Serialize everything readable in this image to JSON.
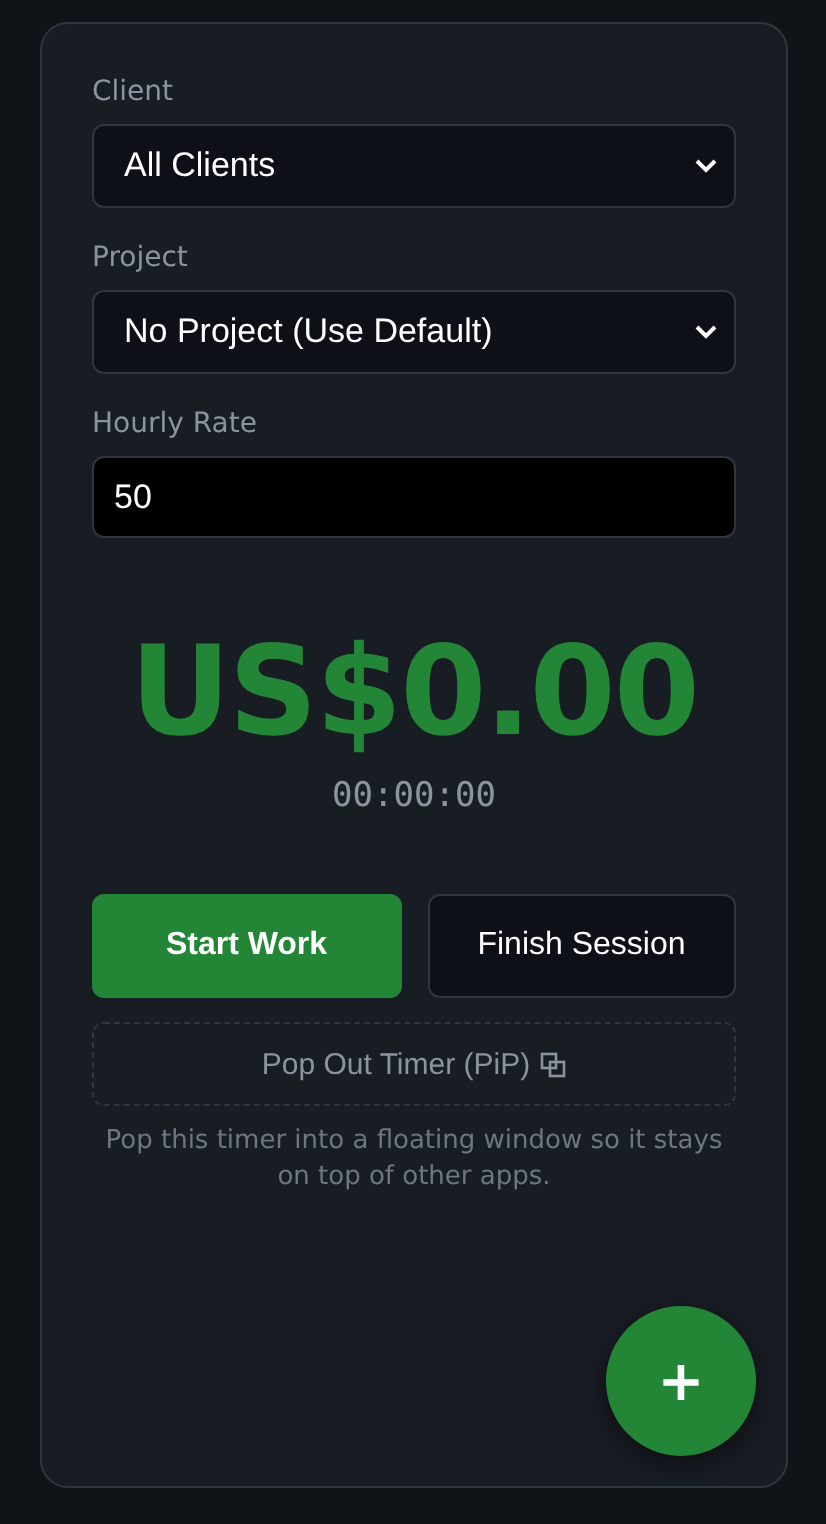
{
  "fields": [
    {
      "kind": "select",
      "label": "Client",
      "value": "All Clients"
    },
    {
      "kind": "select",
      "label": "Project",
      "value": "No Project (Use Default)"
    },
    {
      "kind": "input",
      "label": "Hourly Rate",
      "value": "50"
    }
  ],
  "amount": "US$0.00",
  "elapsed": "00:00:00",
  "buttons": [
    {
      "label": "Start Work",
      "kind": "primary"
    },
    {
      "label": "Finish Session",
      "kind": "secondary"
    }
  ],
  "popout": {
    "label": "Pop Out Timer (PiP)",
    "hint": "Pop this timer into a floating window so it stays on top of other apps."
  },
  "fab": "+"
}
